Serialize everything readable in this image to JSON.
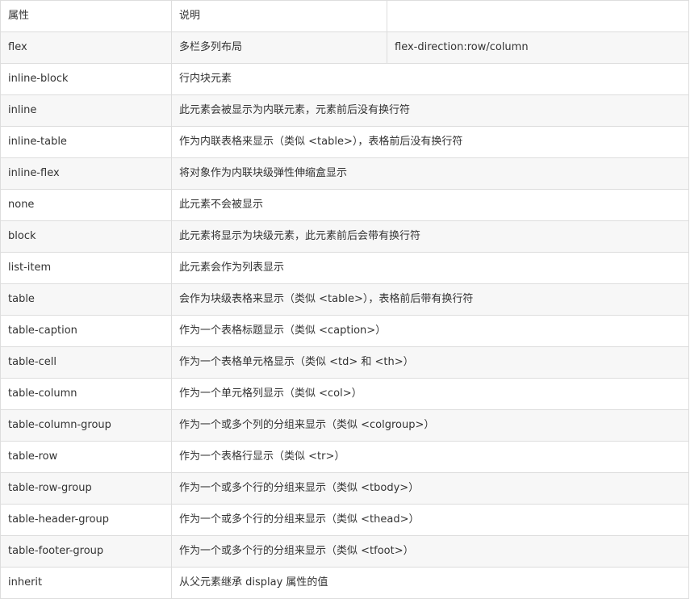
{
  "table": {
    "header": {
      "attr": "属性",
      "desc": "说明",
      "extra": ""
    },
    "first_row": {
      "attr": "flex",
      "desc": "多栏多列布局",
      "extra": "flex-direction:row/column"
    },
    "rows": [
      {
        "attr": "inline-block",
        "desc": "行内块元素"
      },
      {
        "attr": "inline",
        "desc": "此元素会被显示为内联元素，元素前后没有换行符"
      },
      {
        "attr": "inline-table",
        "desc": "作为内联表格来显示（类似 <table>），表格前后没有换行符"
      },
      {
        "attr": "inline-flex",
        "desc": "将对象作为内联块级弹性伸缩盒显示"
      },
      {
        "attr": "none",
        "desc": "此元素不会被显示"
      },
      {
        "attr": "block",
        "desc": "此元素将显示为块级元素，此元素前后会带有换行符"
      },
      {
        "attr": "list-item",
        "desc": "此元素会作为列表显示"
      },
      {
        "attr": "table",
        "desc": "会作为块级表格来显示（类似 <table>），表格前后带有换行符"
      },
      {
        "attr": "table-caption",
        "desc": "作为一个表格标题显示（类似 <caption>）"
      },
      {
        "attr": "table-cell",
        "desc": "作为一个表格单元格显示（类似 <td> 和 <th>）"
      },
      {
        "attr": "table-column",
        "desc": "作为一个单元格列显示（类似 <col>）"
      },
      {
        "attr": "table-column-group",
        "desc": "作为一个或多个列的分组来显示（类似 <colgroup>）"
      },
      {
        "attr": "table-row",
        "desc": "作为一个表格行显示（类似 <tr>）"
      },
      {
        "attr": "table-row-group",
        "desc": "作为一个或多个行的分组来显示（类似 <tbody>）"
      },
      {
        "attr": "table-header-group",
        "desc": "作为一个或多个行的分组来显示（类似 <thead>）"
      },
      {
        "attr": "table-footer-group",
        "desc": "作为一个或多个行的分组来显示（类似 <tfoot>）"
      },
      {
        "attr": "inherit",
        "desc": "从父元素继承 display 属性的值"
      }
    ]
  }
}
